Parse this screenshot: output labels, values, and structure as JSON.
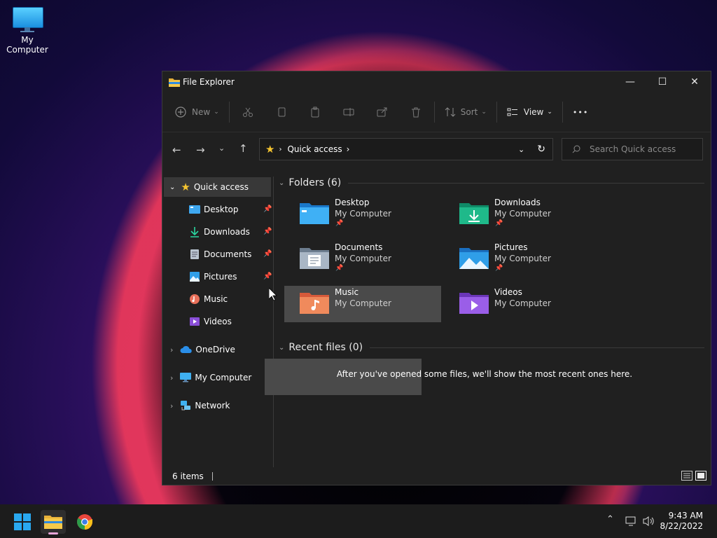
{
  "desktop": {
    "icon_label": "My Computer"
  },
  "window": {
    "title": "File Explorer",
    "controls": {
      "minimize": "—",
      "maximize": "☐",
      "close": "✕"
    }
  },
  "toolbar": {
    "new_label": "New",
    "sort_label": "Sort",
    "view_label": "View",
    "more_label": "•••"
  },
  "address": {
    "crumb": "Quick access",
    "search_placeholder": "Search Quick access"
  },
  "sidebar": {
    "quick_access": "Quick access",
    "items": [
      {
        "label": "Desktop",
        "pinned": true
      },
      {
        "label": "Downloads",
        "pinned": true
      },
      {
        "label": "Documents",
        "pinned": true
      },
      {
        "label": "Pictures",
        "pinned": true
      },
      {
        "label": "Music",
        "pinned": false
      },
      {
        "label": "Videos",
        "pinned": false
      }
    ],
    "onedrive": "OneDrive",
    "my_computer": "My Computer",
    "network": "Network"
  },
  "main": {
    "folders_header": "Folders (6)",
    "folders": [
      {
        "name": "Desktop",
        "location": "My Computer",
        "pinned": true
      },
      {
        "name": "Downloads",
        "location": "My Computer",
        "pinned": true
      },
      {
        "name": "Documents",
        "location": "My Computer",
        "pinned": true
      },
      {
        "name": "Pictures",
        "location": "My Computer",
        "pinned": true
      },
      {
        "name": "Music",
        "location": "My Computer",
        "pinned": false
      },
      {
        "name": "Videos",
        "location": "My Computer",
        "pinned": false
      }
    ],
    "recent_header": "Recent files (0)",
    "recent_empty": "After you've opened some files, we'll show the most recent ones here."
  },
  "status": {
    "items": "6 items"
  },
  "taskbar": {
    "time": "9:43 AM",
    "date": "8/22/2022"
  }
}
